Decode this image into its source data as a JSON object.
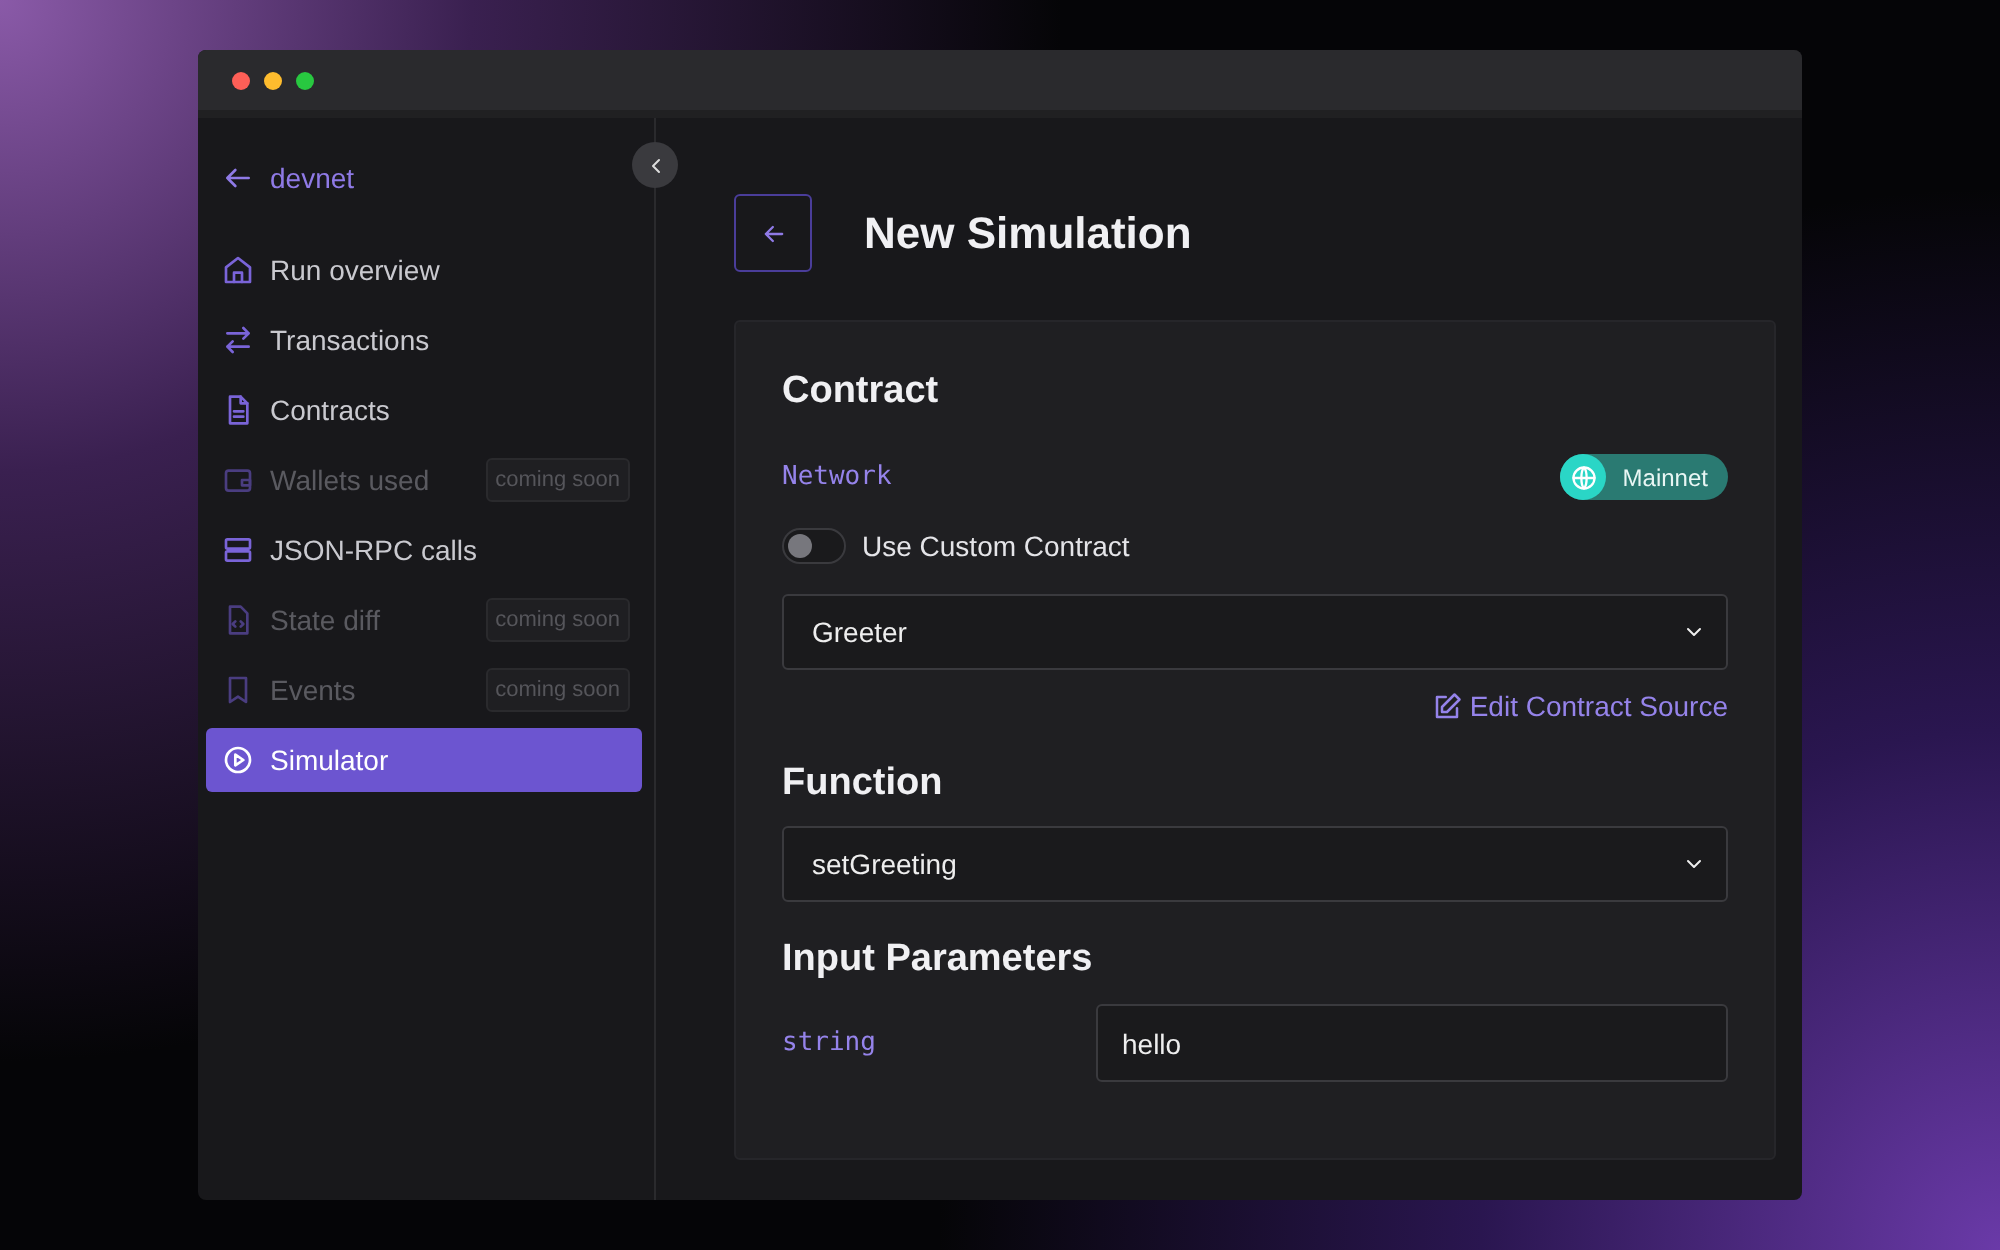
{
  "sidebar": {
    "back_label": "devnet",
    "items": [
      {
        "label": "Run overview",
        "disabled": false,
        "selected": false
      },
      {
        "label": "Transactions",
        "disabled": false,
        "selected": false
      },
      {
        "label": "Contracts",
        "disabled": false,
        "selected": false
      },
      {
        "label": "Wallets used",
        "disabled": true,
        "selected": false,
        "badge": "coming soon"
      },
      {
        "label": "JSON-RPC calls",
        "disabled": false,
        "selected": false
      },
      {
        "label": "State diff",
        "disabled": true,
        "selected": false,
        "badge": "coming soon"
      },
      {
        "label": "Events",
        "disabled": true,
        "selected": false,
        "badge": "coming soon"
      },
      {
        "label": "Simulator",
        "disabled": false,
        "selected": true
      }
    ]
  },
  "page": {
    "title": "New Simulation"
  },
  "contract": {
    "heading": "Contract",
    "network_label": "Network",
    "network": "Mainnet",
    "custom_toggle": {
      "label": "Use Custom Contract",
      "on": false
    },
    "contract_select": "Greeter",
    "edit_link": "Edit Contract Source"
  },
  "function": {
    "heading": "Function",
    "function_select": "setGreeting"
  },
  "inputs": {
    "heading": "Input Parameters",
    "params": [
      {
        "type": "string",
        "value": "hello"
      }
    ]
  }
}
